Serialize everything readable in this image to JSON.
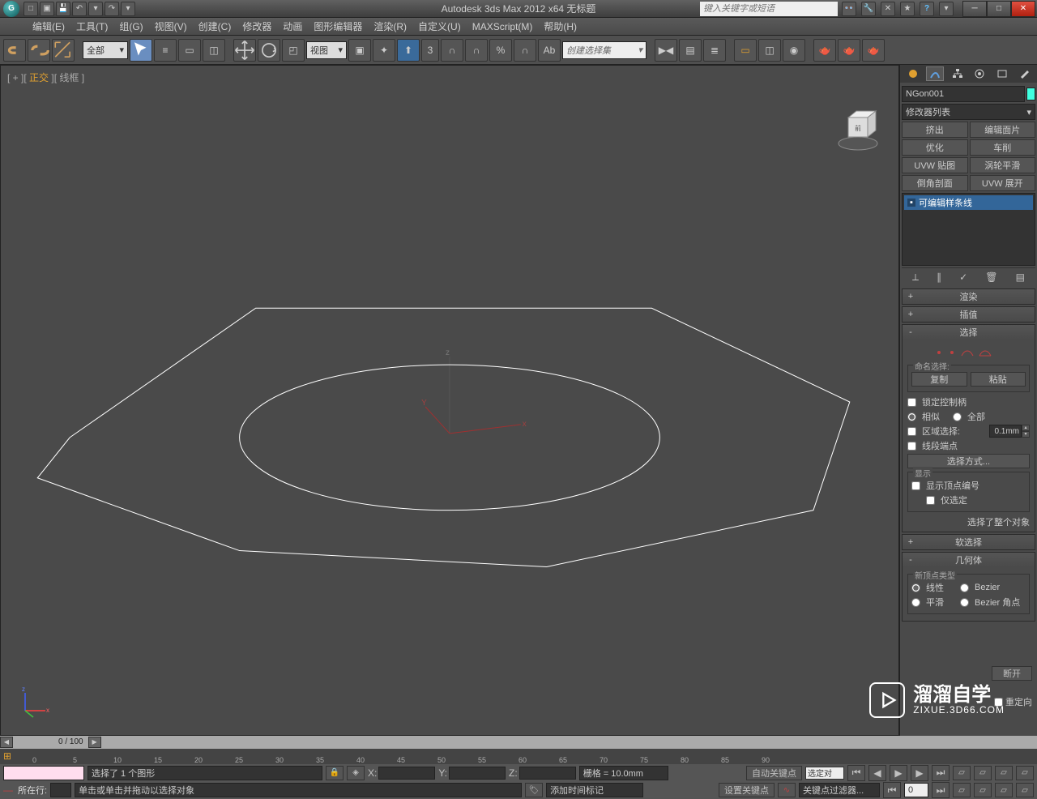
{
  "title": "Autodesk 3ds Max  2012 x64     无标题",
  "search_placeholder": "键入关键字或短语",
  "menus": {
    "edit": "编辑(E)",
    "tools": "工具(T)",
    "group": "组(G)",
    "views": "视图(V)",
    "create": "创建(C)",
    "modifiers": "修改器",
    "animation": "动画",
    "graph": "图形编辑器",
    "rendering": "渲染(R)",
    "customize": "自定义(U)",
    "maxscript": "MAXScript(M)",
    "help": "帮助(H)"
  },
  "toolbar": {
    "all": "全部",
    "view": "视图",
    "named_set": "创建选择集"
  },
  "viewport": {
    "label_pre": "[ + ]",
    "label_ortho": "正交",
    "label_wire": "[ 线框 ]",
    "axis_x": "x",
    "axis_y": "y",
    "axis_z": "z"
  },
  "panel": {
    "object_name": "NGon001",
    "modifier_list": "修改器列表",
    "mods": {
      "extrude": "挤出",
      "editpatch": "编辑面片",
      "optimize": "优化",
      "lathe": "车削",
      "uvwmap": "UVW 贴图",
      "turbo": "涡轮平滑",
      "chamfer": "倒角剖面",
      "uvwunwrap": "UVW 展开"
    },
    "stack_item": "可编辑样条线",
    "rollouts": {
      "render": "渲染",
      "interp": "插值",
      "select": "选择",
      "soft": "软选择",
      "geom": "几何体"
    },
    "select": {
      "named_sel": "命名选择:",
      "copy": "复制",
      "paste": "粘贴",
      "lock": "锁定控制柄",
      "similar": "相似",
      "all": "全部",
      "area": "区域选择:",
      "area_val": "0.1mm",
      "segment_end": "线段端点",
      "select_by": "选择方式...",
      "display": "显示",
      "show_vert": "显示顶点编号",
      "only_sel": "仅选定",
      "whole": "选择了整个对象"
    },
    "geom": {
      "new_vert": "新顶点类型",
      "linear": "线性",
      "bezier": "Bezier",
      "smooth": "平滑",
      "bezier_corner": "Bezier 角点",
      "break": "断开",
      "reorient": "重定向"
    }
  },
  "timeline": {
    "frame": "0 / 100"
  },
  "status": {
    "selected": "选择了 1 个图形",
    "hint": "单击或单击并拖动以选择对象",
    "grid": "栅格 = 10.0mm",
    "auto_key": "自动关键点",
    "sel_obj": "选定对",
    "set_key": "设置关键点",
    "key_filter": "关键点过滤器...",
    "add_marker": "添加时间标记",
    "current": "所在行:",
    "x": "X:",
    "y": "Y:",
    "z": "Z:",
    "frame0": "0"
  },
  "watermark": {
    "name": "溜溜自学",
    "url": "ZIXUE.3D66.COM"
  },
  "coord_label": {
    "x": "x",
    "y": "Y",
    "z": "z"
  }
}
